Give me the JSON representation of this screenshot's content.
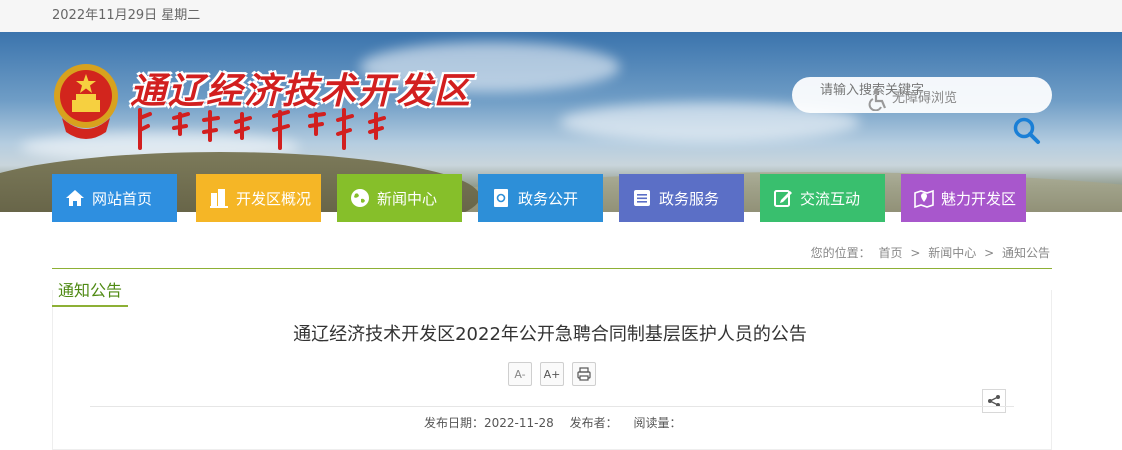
{
  "header": {
    "date_text": "2022年11月29日 星期二",
    "site_name": "通辽经济技术开发区",
    "search": {
      "placeholder": "请输入搜索关键字",
      "accessibility_label": "无障碍浏览",
      "search_icon": "search-icon"
    }
  },
  "nav": {
    "items": [
      {
        "label": "网站首页",
        "icon": "home-icon",
        "color": "#2e8fe0"
      },
      {
        "label": "开发区概况",
        "icon": "buildings-icon",
        "color": "#f5b626"
      },
      {
        "label": "新闻中心",
        "icon": "globe-icon",
        "color": "#86bf2a"
      },
      {
        "label": "政务公开",
        "icon": "document-at-icon",
        "color": "#2d8fd8"
      },
      {
        "label": "政务服务",
        "icon": "list-icon",
        "color": "#5b6fc6"
      },
      {
        "label": "交流互动",
        "icon": "edit-icon",
        "color": "#39bf6e"
      },
      {
        "label": "魅力开发区",
        "icon": "map-pin-icon",
        "color": "#a857cc"
      }
    ]
  },
  "breadcrumb": {
    "prefix": "您的位置：",
    "items": [
      "首页",
      "新闻中心",
      "通知公告"
    ],
    "separator": ">"
  },
  "section": {
    "title": "通知公告"
  },
  "article": {
    "title": "通辽经济技术开发区2022年公开急聘合同制基层医护人员的公告",
    "tools": {
      "font_smaller": "A-",
      "font_larger": "A+",
      "print_icon": "print-icon"
    },
    "share_icon": "share-icon",
    "meta": {
      "publish_date_label": "发布日期：",
      "publish_date": "2022-11-28",
      "publisher_label": "发布者：",
      "publisher": "",
      "views_label": "阅读量：",
      "views": ""
    }
  },
  "colors": {
    "accent_green": "#8db035",
    "title_red": "#d21f1f"
  }
}
